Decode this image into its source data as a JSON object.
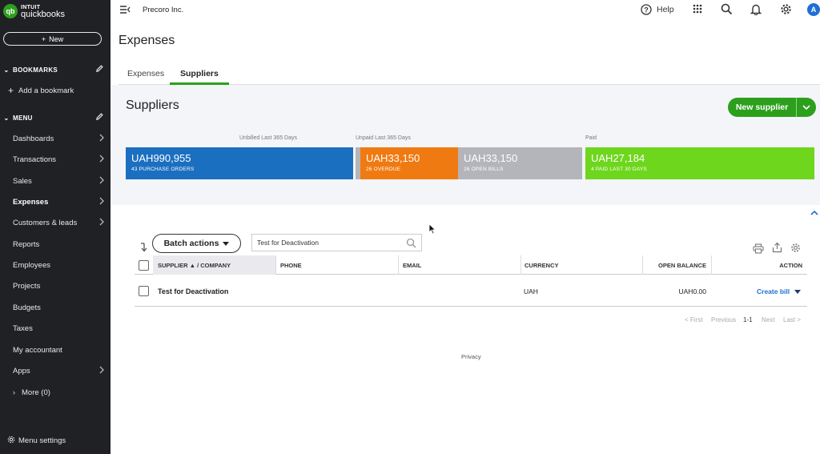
{
  "sidebar": {
    "logo_brand": "INTUIT",
    "logo_product": "quickbooks",
    "logo_mark": "qb",
    "new_label": "New",
    "bookmarks_label": "BOOKMARKS",
    "add_bookmark_label": "Add a bookmark",
    "menu_label": "MENU",
    "items": [
      {
        "label": "Dashboards",
        "has_arrow": true
      },
      {
        "label": "Transactions",
        "has_arrow": true
      },
      {
        "label": "Sales",
        "has_arrow": true
      },
      {
        "label": "Expenses",
        "has_arrow": true,
        "active": true
      },
      {
        "label": "Customers & leads",
        "has_arrow": true
      },
      {
        "label": "Reports",
        "has_arrow": false
      },
      {
        "label": "Employees",
        "has_arrow": false
      },
      {
        "label": "Projects",
        "has_arrow": false
      },
      {
        "label": "Budgets",
        "has_arrow": false
      },
      {
        "label": "Taxes",
        "has_arrow": false
      },
      {
        "label": "My accountant",
        "has_arrow": false
      },
      {
        "label": "Apps",
        "has_arrow": true
      }
    ],
    "more_label": "More (0)",
    "menu_settings_label": "Menu settings"
  },
  "topbar": {
    "company": "Precoro Inc.",
    "help_label": "Help",
    "avatar_initial": "A",
    "icons": [
      "menu-collapse-icon",
      "help-icon",
      "apps-grid-icon",
      "search-icon",
      "bell-icon",
      "gear-icon"
    ]
  },
  "page": {
    "title": "Expenses",
    "tabs": [
      {
        "label": "Expenses",
        "active": false
      },
      {
        "label": "Suppliers",
        "active": true
      }
    ]
  },
  "suppliers_panel": {
    "title": "Suppliers",
    "new_supplier_label": "New supplier",
    "labels": {
      "unbilled": "Unbilled Last 365 Days",
      "unpaid": "Unpaid Last 365 Days",
      "paid": "Paid"
    },
    "bars": [
      {
        "amount": "UAH990,955",
        "sub": "43 PURCHASE ORDERS",
        "color": "#1b6fc0"
      },
      {
        "amount": "UAH33,150",
        "sub": "26 OVERDUE",
        "color": "#f07a12"
      },
      {
        "amount": "UAH33,150",
        "sub": "26 OPEN BILLS",
        "color": "#b3b5ba"
      },
      {
        "amount": "UAH27,184",
        "sub": "4 PAID LAST 30 DAYS",
        "color": "#6ed61c"
      }
    ]
  },
  "table": {
    "batch_actions_label": "Batch actions",
    "search_value": "Test for Deactivation",
    "columns": {
      "supplier": "SUPPLIER ▲ / COMPANY",
      "phone": "PHONE",
      "email": "EMAIL",
      "currency": "CURRENCY",
      "balance": "OPEN BALANCE",
      "action": "ACTION"
    },
    "rows": [
      {
        "supplier": "Test for Deactivation",
        "phone": "",
        "email": "",
        "currency": "UAH",
        "balance": "UAH0.00",
        "action": "Create bill"
      }
    ],
    "pagination": {
      "first": "< First",
      "previous": "Previous",
      "range": "1-1",
      "next": "Next",
      "last": "Last >"
    }
  },
  "footer": {
    "privacy": "Privacy"
  },
  "colors": {
    "brand_green": "#2ca01c",
    "link_blue": "#1f6fd4",
    "sidebar_bg": "#202124"
  }
}
